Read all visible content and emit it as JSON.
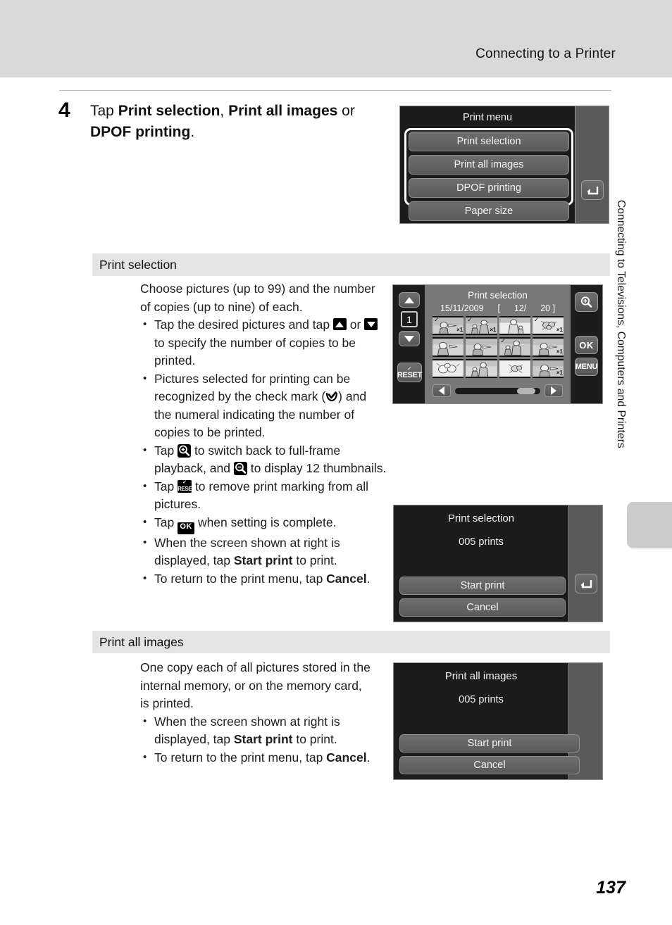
{
  "header": {
    "running_head": "Connecting to a Printer"
  },
  "side_tab": {
    "text": "Connecting to Televisions, Computers and Printers"
  },
  "step": {
    "number": "4",
    "text_parts": {
      "lead": "Tap ",
      "bold1": "Print selection",
      "sep1": ", ",
      "bold2": "Print all images",
      "sep2": " or ",
      "bold3": "DPOF printing",
      "end": "."
    }
  },
  "print_menu_screen": {
    "title": "Print menu",
    "items": [
      {
        "label": "Print selection",
        "highlighted": true
      },
      {
        "label": "Print all images",
        "highlighted": true
      },
      {
        "label": "DPOF printing",
        "highlighted": true
      },
      {
        "label": "Paper size",
        "highlighted": false
      }
    ],
    "back_icon": "back-arrow-icon"
  },
  "sections": [
    {
      "id": "print-selection",
      "heading": "Print selection",
      "intro": "Choose pictures (up to 99) and the number of copies (up to nine) of each.",
      "bullets": [
        {
          "segments": [
            {
              "t": "text",
              "v": "Tap the desired pictures and tap "
            },
            {
              "t": "icon",
              "v": "up-arrow-icon"
            },
            {
              "t": "text",
              "v": " or "
            },
            {
              "t": "icon",
              "v": "down-arrow-icon"
            },
            {
              "t": "text",
              "v": " to specify the number of copies to be printed."
            }
          ]
        },
        {
          "segments": [
            {
              "t": "text",
              "v": "Pictures selected for printing can be recognized by the check mark ("
            },
            {
              "t": "icon",
              "v": "check-mark-icon"
            },
            {
              "t": "text",
              "v": ") and the numeral indicating the number of copies to be printed."
            }
          ]
        },
        {
          "segments": [
            {
              "t": "text",
              "v": "Tap "
            },
            {
              "t": "icon",
              "v": "zoom-in-icon"
            },
            {
              "t": "text",
              "v": " to switch back to full-frame playback, and "
            },
            {
              "t": "icon",
              "v": "zoom-out-icon"
            },
            {
              "t": "text",
              "v": " to display 12 thumbnails."
            }
          ]
        },
        {
          "segments": [
            {
              "t": "text",
              "v": "Tap "
            },
            {
              "t": "icon",
              "v": "reset-icon"
            },
            {
              "t": "text",
              "v": " to remove print marking from all pictures."
            }
          ]
        },
        {
          "segments": [
            {
              "t": "text",
              "v": "Tap "
            },
            {
              "t": "icon",
              "v": "ok-icon"
            },
            {
              "t": "text",
              "v": " when setting is complete."
            }
          ]
        },
        {
          "segments": [
            {
              "t": "text",
              "v": "When the screen shown at right is displayed, tap "
            },
            {
              "t": "bold",
              "v": "Start print"
            },
            {
              "t": "text",
              "v": " to print."
            }
          ]
        },
        {
          "segments": [
            {
              "t": "text",
              "v": "To return to the print menu, tap "
            },
            {
              "t": "bold",
              "v": "Cancel"
            },
            {
              "t": "text",
              "v": "."
            }
          ]
        }
      ]
    },
    {
      "id": "print-all-images",
      "heading": "Print all images",
      "intro": "One copy each of all pictures stored in the internal memory, or on the memory card, is printed.",
      "bullets": [
        {
          "segments": [
            {
              "t": "text",
              "v": "When the screen shown at right is displayed, tap "
            },
            {
              "t": "bold",
              "v": "Start print"
            },
            {
              "t": "text",
              "v": " to print."
            }
          ]
        },
        {
          "segments": [
            {
              "t": "text",
              "v": "To return to the print menu, tap "
            },
            {
              "t": "bold",
              "v": "Cancel"
            },
            {
              "t": "text",
              "v": "."
            }
          ]
        }
      ]
    }
  ],
  "print_selection_screen": {
    "title": "Print selection",
    "date": "15/11/2009",
    "bracket_open": "[",
    "current": "12/",
    "total": "20 ]",
    "copies_counter": "1",
    "reset_label": "RESET",
    "ok_label": "OK",
    "menu_label": "MENU",
    "up_icon": "up-arrow-button",
    "down_icon": "down-arrow-button",
    "zoom_icon": "zoom-in-button",
    "scroll_left_icon": "scroll-left-arrow",
    "scroll_right_icon": "scroll-right-arrow",
    "thumbnails": [
      {
        "scene": "beach",
        "checked": true,
        "count": "1"
      },
      {
        "scene": "family",
        "checked": true,
        "count": "1"
      },
      {
        "scene": "person",
        "checked": false,
        "count": ""
      },
      {
        "scene": "flower",
        "checked": true,
        "count": "1"
      },
      {
        "scene": "portrait",
        "checked": false,
        "count": ""
      },
      {
        "scene": "beach",
        "checked": false,
        "count": ""
      },
      {
        "scene": "family",
        "checked": true,
        "count": ""
      },
      {
        "scene": "beach",
        "checked": false,
        "count": "1"
      },
      {
        "scene": "flower",
        "checked": false,
        "count": ""
      },
      {
        "scene": "family",
        "checked": false,
        "count": ""
      },
      {
        "scene": "flower",
        "checked": false,
        "count": ""
      },
      {
        "scene": "portrait",
        "checked": false,
        "count": "1"
      }
    ]
  },
  "print_selection_confirm": {
    "title": "Print selection",
    "count": "005 prints",
    "start_label": "Start print",
    "cancel_label": "Cancel",
    "back_icon": "back-arrow-icon"
  },
  "print_all_confirm": {
    "title": "Print all images",
    "count": "005 prints",
    "start_label": "Start print",
    "cancel_label": "Cancel"
  },
  "page_number": "137",
  "colors": {
    "header_band": "#d9d9d9",
    "section_bar": "#e4e4e4",
    "lcd_bg": "#1c1c1c",
    "lcd_side": "#5a5a5a",
    "thumb_bg": "#787878"
  }
}
